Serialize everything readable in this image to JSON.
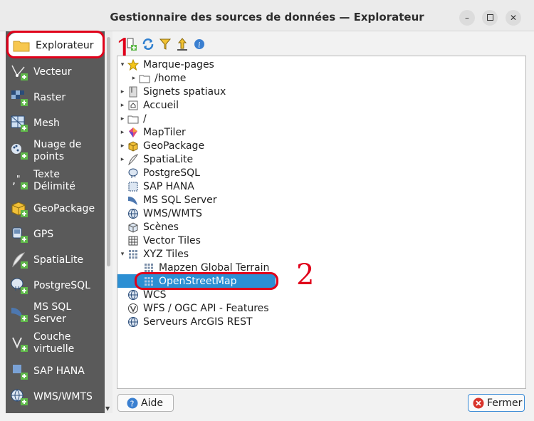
{
  "window": {
    "title": "Gestionnaire des sources de données — Explorateur"
  },
  "sidebar": {
    "items": [
      {
        "label": "Explorateur",
        "icon": "folder-icon"
      },
      {
        "label": "Vecteur",
        "icon": "vector-icon"
      },
      {
        "label": "Raster",
        "icon": "raster-icon"
      },
      {
        "label": "Mesh",
        "icon": "mesh-icon"
      },
      {
        "label": "Nuage de points",
        "icon": "point-cloud-icon"
      },
      {
        "label": "Texte Délimité",
        "icon": "delimited-text-icon"
      },
      {
        "label": "GeoPackage",
        "icon": "geopackage-icon"
      },
      {
        "label": "GPS",
        "icon": "gps-icon"
      },
      {
        "label": "SpatiaLite",
        "icon": "spatialite-icon"
      },
      {
        "label": "PostgreSQL",
        "icon": "postgresql-icon"
      },
      {
        "label": "MS SQL Server",
        "icon": "mssql-icon"
      },
      {
        "label": "Couche virtuelle",
        "icon": "virtual-layer-icon"
      },
      {
        "label": "SAP HANA",
        "icon": "sap-hana-icon"
      },
      {
        "label": "WMS/WMTS",
        "icon": "wms-icon"
      }
    ]
  },
  "tree": {
    "rows": [
      {
        "label": "Marque-pages",
        "expander": "▾",
        "icon": "star-icon"
      },
      {
        "label": "/home",
        "expander": "▸",
        "icon": "folder-icon"
      },
      {
        "label": "Signets spatiaux",
        "expander": "▸",
        "icon": "spatial-bookmarks-icon"
      },
      {
        "label": "Accueil",
        "expander": "▸",
        "icon": "home-icon"
      },
      {
        "label": "/",
        "expander": "▸",
        "icon": "folder-icon"
      },
      {
        "label": "MapTiler",
        "expander": "▸",
        "icon": "maptiler-icon"
      },
      {
        "label": "GeoPackage",
        "expander": "▸",
        "icon": "geopackage-icon"
      },
      {
        "label": "SpatiaLite",
        "expander": "▸",
        "icon": "spatialite-icon"
      },
      {
        "label": "PostgreSQL",
        "expander": "",
        "icon": "postgresql-icon"
      },
      {
        "label": "SAP HANA",
        "expander": "",
        "icon": "sap-hana-icon"
      },
      {
        "label": "MS SQL Server",
        "expander": "",
        "icon": "mssql-icon"
      },
      {
        "label": "WMS/WMTS",
        "expander": "",
        "icon": "globe-icon"
      },
      {
        "label": "Scènes",
        "expander": "",
        "icon": "scenes-icon"
      },
      {
        "label": "Vector Tiles",
        "expander": "",
        "icon": "vector-tiles-icon"
      },
      {
        "label": "XYZ Tiles",
        "expander": "▾",
        "icon": "xyz-tiles-icon"
      },
      {
        "label": "Mapzen Global Terrain",
        "expander": "",
        "icon": "xyz-tiles-icon"
      },
      {
        "label": "OpenStreetMap",
        "expander": "",
        "icon": "xyz-tiles-icon"
      },
      {
        "label": "WCS",
        "expander": "",
        "icon": "globe-icon"
      },
      {
        "label": "WFS / OGC API - Features",
        "expander": "",
        "icon": "wfs-icon"
      },
      {
        "label": "Serveurs ArcGIS REST",
        "expander": "",
        "icon": "globe-icon"
      }
    ]
  },
  "annotations": {
    "one": "1",
    "two": "2"
  },
  "buttons": {
    "help": "Aide",
    "close": "Fermer"
  },
  "colors": {
    "sidebar_bg": "#5a5a5a",
    "selection": "#2c8fd3",
    "annotation": "#e0001a"
  }
}
